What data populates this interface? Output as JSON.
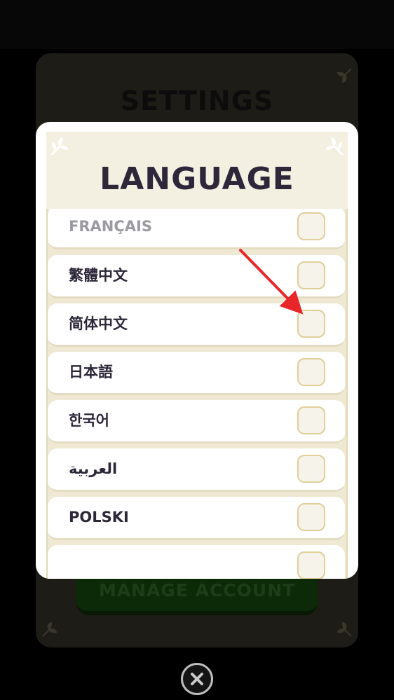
{
  "background": {
    "settings_title": "SETTINGS",
    "manage_account_label": "MANAGE ACCOUNT"
  },
  "modal": {
    "title": "LANGUAGE",
    "languages": [
      {
        "label": "FRANÇAIS",
        "checked": false
      },
      {
        "label": "繁體中文",
        "checked": false
      },
      {
        "label": "简体中文",
        "checked": false
      },
      {
        "label": "日本語",
        "checked": false
      },
      {
        "label": "한국어",
        "checked": false
      },
      {
        "label": "العربية",
        "checked": false
      },
      {
        "label": "POLSKI",
        "checked": false
      },
      {
        "label": "",
        "checked": false
      }
    ]
  },
  "colors": {
    "title_text": "#2d2739",
    "header_bg": "#f3efe1",
    "checkbox_border": "#e0cf9a",
    "annotation_arrow": "#e8262a"
  },
  "icons": {
    "close": "close-icon",
    "corner": "leaf-ornament-icon",
    "annotation": "red-arrow-icon"
  }
}
